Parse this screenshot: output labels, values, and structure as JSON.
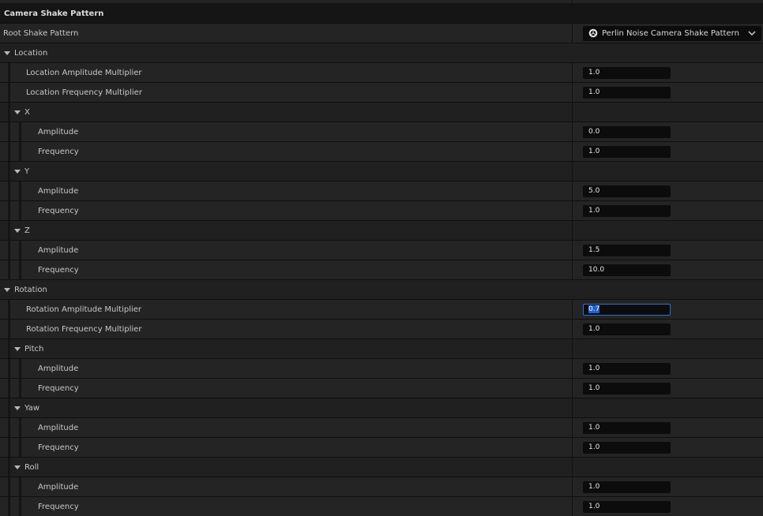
{
  "header": {
    "title": "Camera Shake Pattern"
  },
  "root_shake": {
    "label": "Root Shake Pattern",
    "value": "Perlin Noise Camera Shake Pattern",
    "icon": "shake-pattern-icon"
  },
  "location": {
    "label": "Location",
    "amplitude_multiplier": {
      "label": "Location Amplitude Multiplier",
      "value": "1.0"
    },
    "frequency_multiplier": {
      "label": "Location Frequency Multiplier",
      "value": "1.0"
    },
    "x": {
      "label": "X",
      "amplitude": {
        "label": "Amplitude",
        "value": "0.0"
      },
      "frequency": {
        "label": "Frequency",
        "value": "1.0"
      }
    },
    "y": {
      "label": "Y",
      "amplitude": {
        "label": "Amplitude",
        "value": "5.0"
      },
      "frequency": {
        "label": "Frequency",
        "value": "1.0"
      }
    },
    "z": {
      "label": "Z",
      "amplitude": {
        "label": "Amplitude",
        "value": "1.5"
      },
      "frequency": {
        "label": "Frequency",
        "value": "10.0"
      }
    }
  },
  "rotation": {
    "label": "Rotation",
    "amplitude_multiplier": {
      "label": "Rotation Amplitude Multiplier",
      "value": "0.7"
    },
    "frequency_multiplier": {
      "label": "Rotation Frequency Multiplier",
      "value": "1.0"
    },
    "pitch": {
      "label": "Pitch",
      "amplitude": {
        "label": "Amplitude",
        "value": "1.0"
      },
      "frequency": {
        "label": "Frequency",
        "value": "1.0"
      }
    },
    "yaw": {
      "label": "Yaw",
      "amplitude": {
        "label": "Amplitude",
        "value": "1.0"
      },
      "frequency": {
        "label": "Frequency",
        "value": "1.0"
      }
    },
    "roll": {
      "label": "Roll",
      "amplitude": {
        "label": "Amplitude",
        "value": "1.0"
      },
      "frequency": {
        "label": "Frequency",
        "value": "1.0"
      }
    }
  },
  "colors": {
    "background": "#151515",
    "row": "#242424",
    "input": "#0c0c0c",
    "focus": "#2a6fd6"
  }
}
